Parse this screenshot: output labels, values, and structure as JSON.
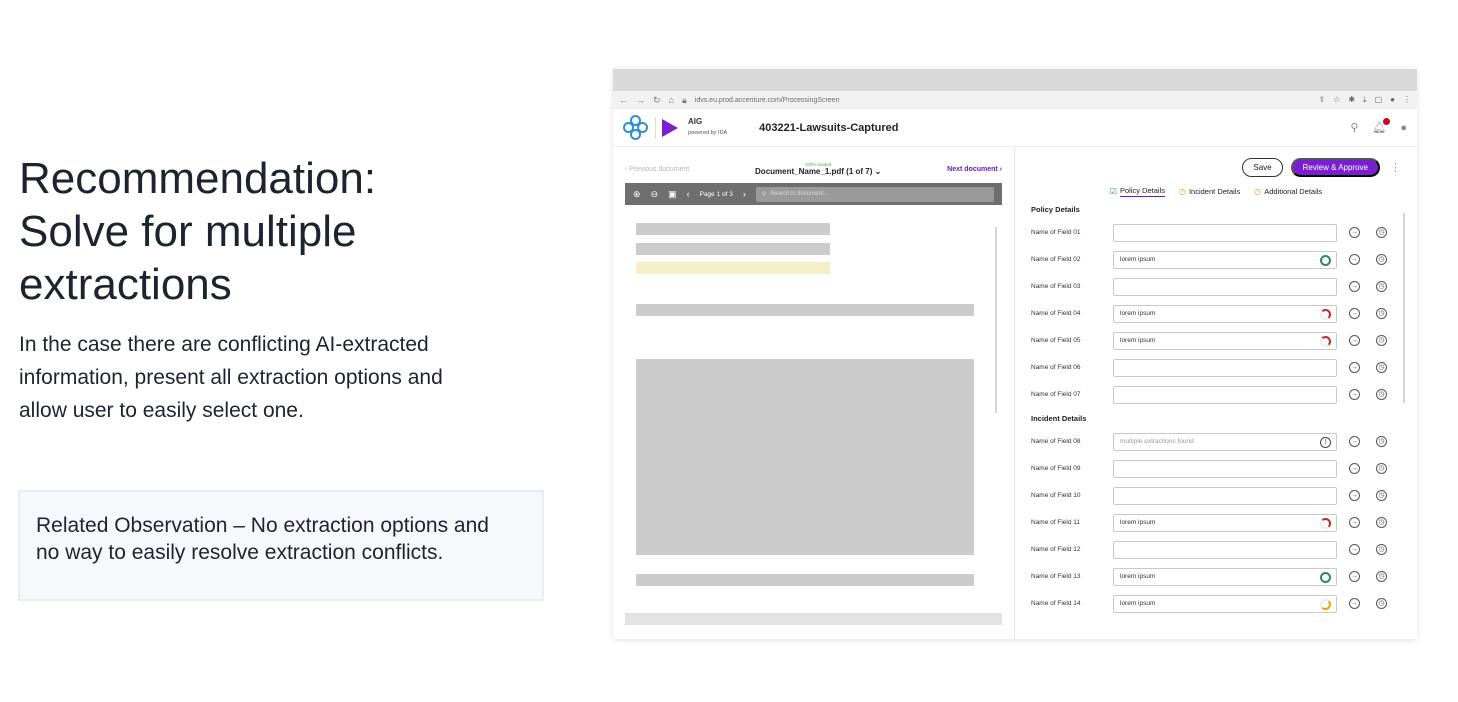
{
  "slide": {
    "title_line1": "Recommendation:",
    "title_line2": "Solve for multiple",
    "title_line3": "extractions",
    "body_line1": "In the case there are conflicting AI-extracted",
    "body_line2": "information, present all extraction options and",
    "body_line3": "allow user to easily select one.",
    "observation_line1": "Related Observation – No extraction options and",
    "observation_line2": "no way to easily resolve extraction conflicts."
  },
  "browser": {
    "url": "idvs.eu.prod.accenture.com/ProcessingScreen"
  },
  "app": {
    "brand": "AIG",
    "brand_sub": "powered by IDA",
    "case_title": "403221-Lawsuits-Captured"
  },
  "document": {
    "prev_label": "Previous document",
    "next_label": "Next document",
    "status": "100% loaded",
    "name": "Document_Name_1.pdf (1 of 7)",
    "page_label": "Page 1 of 3",
    "search_placeholder": "Search in document..."
  },
  "form": {
    "save_label": "Save",
    "review_label": "Review & Approve",
    "tabs": [
      {
        "label": "Policy Details",
        "icon": "check-square-icon"
      },
      {
        "label": "Incident Details",
        "icon": "clock-icon"
      },
      {
        "label": "Additional Details",
        "icon": "clock-icon"
      }
    ],
    "section_policy": "Policy Details",
    "section_incident": "Incident Details",
    "fields": [
      {
        "label": "Name of Field 01",
        "value": "",
        "confidence": "none"
      },
      {
        "label": "Name of Field 02",
        "value": "lorem ipsum",
        "confidence": "high"
      },
      {
        "label": "Name of Field 03",
        "value": "",
        "confidence": "none"
      },
      {
        "label": "Name of Field 04",
        "value": "lorem ipsum",
        "confidence": "low"
      },
      {
        "label": "Name of Field 05",
        "value": "lorem ipsum",
        "confidence": "low"
      },
      {
        "label": "Name of Field 06",
        "value": "",
        "confidence": "none"
      },
      {
        "label": "Name of Field 07",
        "value": "",
        "confidence": "none"
      },
      {
        "label": "Name of Field 08",
        "value": "multiple extractions found",
        "confidence": "warn"
      },
      {
        "label": "Name of Field 09",
        "value": "",
        "confidence": "none"
      },
      {
        "label": "Name of Field 10",
        "value": "",
        "confidence": "none"
      },
      {
        "label": "Name of Field 11",
        "value": "lorem ipsum",
        "confidence": "low"
      },
      {
        "label": "Name of Field 12",
        "value": "",
        "confidence": "none"
      },
      {
        "label": "Name of Field 13",
        "value": "lorem ipsum",
        "confidence": "high"
      },
      {
        "label": "Name of Field 14",
        "value": "lorem ipsum",
        "confidence": "mid"
      }
    ]
  }
}
